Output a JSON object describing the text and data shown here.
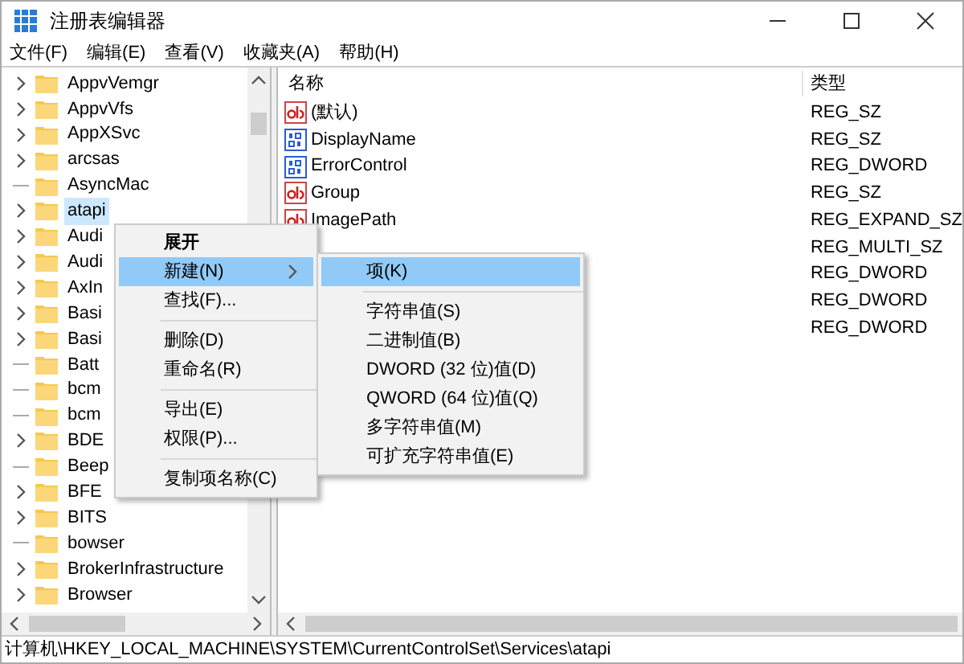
{
  "window": {
    "title": "注册表编辑器"
  },
  "menu": [
    "文件(F)",
    "编辑(E)",
    "查看(V)",
    "收藏夹(A)",
    "帮助(H)"
  ],
  "tree": [
    {
      "name": "AppvVemgr",
      "expandable": true,
      "selected": false
    },
    {
      "name": "AppvVfs",
      "expandable": true,
      "selected": false
    },
    {
      "name": "AppXSvc",
      "expandable": true,
      "selected": false
    },
    {
      "name": "arcsas",
      "expandable": true,
      "selected": false
    },
    {
      "name": "AsyncMac",
      "expandable": false,
      "selected": false
    },
    {
      "name": "atapi",
      "expandable": true,
      "selected": true
    },
    {
      "name": "Audi",
      "expandable": true,
      "selected": false
    },
    {
      "name": "Audi",
      "expandable": true,
      "selected": false
    },
    {
      "name": "AxIn",
      "expandable": true,
      "selected": false
    },
    {
      "name": "Basi",
      "expandable": true,
      "selected": false
    },
    {
      "name": "Basi",
      "expandable": true,
      "selected": false
    },
    {
      "name": "Batt",
      "expandable": false,
      "selected": false
    },
    {
      "name": "bcm",
      "expandable": false,
      "selected": false
    },
    {
      "name": "bcm",
      "expandable": false,
      "selected": false
    },
    {
      "name": "BDE",
      "expandable": true,
      "selected": false
    },
    {
      "name": "Beep",
      "expandable": false,
      "selected": false
    },
    {
      "name": "BFE",
      "expandable": true,
      "selected": false
    },
    {
      "name": "BITS",
      "expandable": true,
      "selected": false
    },
    {
      "name": "bowser",
      "expandable": false,
      "selected": false
    },
    {
      "name": "BrokerInfrastructure",
      "expandable": true,
      "selected": false
    },
    {
      "name": "Browser",
      "expandable": true,
      "selected": false
    }
  ],
  "values": {
    "columns": [
      "名称",
      "类型"
    ],
    "rows": [
      {
        "kind": "string",
        "name": "(默认)",
        "type": "REG_SZ"
      },
      {
        "kind": "binary",
        "name": "DisplayName",
        "type": "REG_SZ"
      },
      {
        "kind": "binary",
        "name": "ErrorControl",
        "type": "REG_DWORD"
      },
      {
        "kind": "string",
        "name": "Group",
        "type": "REG_SZ"
      },
      {
        "kind": "string",
        "name": "ImagePath",
        "type": "REG_EXPAND_SZ"
      },
      {
        "kind": "hidden",
        "type": "REG_MULTI_SZ"
      },
      {
        "kind": "hidden",
        "type": "REG_DWORD"
      },
      {
        "kind": "hidden",
        "type": "REG_DWORD"
      },
      {
        "kind": "hidden",
        "type": "REG_DWORD"
      }
    ]
  },
  "context_menu": [
    {
      "label": "展开",
      "kind": "default",
      "selected": false,
      "submenu": false
    },
    {
      "label": "新建(N)",
      "kind": "item",
      "selected": true,
      "submenu": true
    },
    {
      "label": "查找(F)...",
      "kind": "item",
      "selected": false,
      "submenu": false
    },
    {
      "kind": "separator"
    },
    {
      "label": "删除(D)",
      "kind": "item",
      "selected": false,
      "submenu": false
    },
    {
      "label": "重命名(R)",
      "kind": "item",
      "selected": false,
      "submenu": false
    },
    {
      "kind": "separator"
    },
    {
      "label": "导出(E)",
      "kind": "item",
      "selected": false,
      "submenu": false
    },
    {
      "label": "权限(P)...",
      "kind": "item",
      "selected": false,
      "submenu": false
    },
    {
      "kind": "separator"
    },
    {
      "label": "复制项名称(C)",
      "kind": "item",
      "selected": false,
      "submenu": false
    }
  ],
  "submenu": [
    {
      "label": "项(K)",
      "kind": "item",
      "selected": true
    },
    {
      "kind": "separator"
    },
    {
      "label": "字符串值(S)",
      "kind": "item",
      "selected": false
    },
    {
      "label": "二进制值(B)",
      "kind": "item",
      "selected": false
    },
    {
      "label": "DWORD (32 位)值(D)",
      "kind": "item",
      "selected": false
    },
    {
      "label": "QWORD (64 位)值(Q)",
      "kind": "item",
      "selected": false
    },
    {
      "label": "多字符串值(M)",
      "kind": "item",
      "selected": false
    },
    {
      "label": "可扩充字符串值(E)",
      "kind": "item",
      "selected": false
    }
  ],
  "status_bar": "计算机\\HKEY_LOCAL_MACHINE\\SYSTEM\\CurrentControlSet\\Services\\atapi"
}
